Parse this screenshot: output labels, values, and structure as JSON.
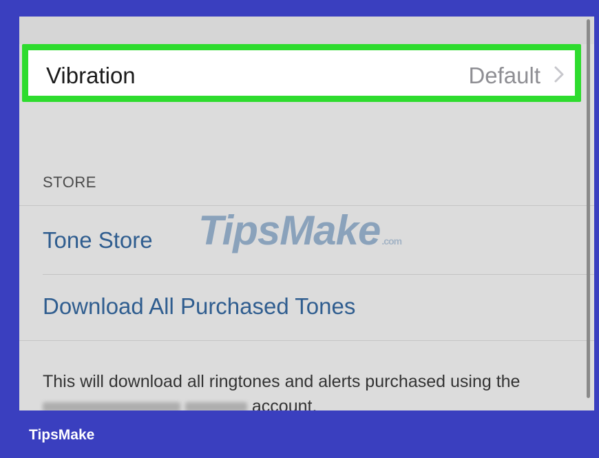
{
  "settings": {
    "vibration": {
      "label": "Vibration",
      "value": "Default"
    },
    "store": {
      "header": "STORE",
      "tone_store": "Tone Store",
      "download_all": "Download All Purchased Tones",
      "footer_prefix": "This will download all ringtones and alerts purchased using the",
      "footer_suffix": "account."
    }
  },
  "watermark": {
    "main": "TipsMake",
    "suffix": ".com"
  },
  "brand": {
    "name": "TipsMake"
  },
  "colors": {
    "highlight": "#2edc2e",
    "link": "#2f5d8f",
    "frame": "#3a3fbf",
    "background": "#dcdcdc"
  },
  "icons": {
    "vibration_chevron": "chevron-right-icon"
  }
}
